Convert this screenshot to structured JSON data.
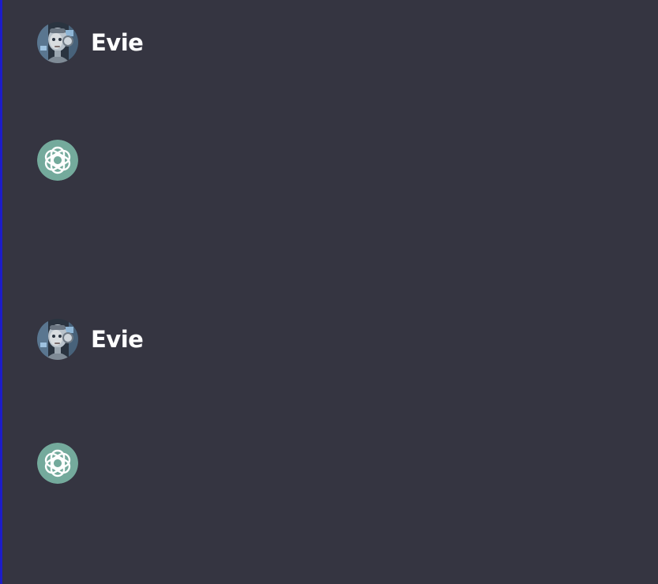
{
  "messages": [
    {
      "role": "user",
      "sender": "Evie",
      "avatar_icon": "robot-avatar-icon"
    },
    {
      "role": "assistant",
      "sender": "",
      "avatar_icon": "openai-logo-icon"
    },
    {
      "role": "user",
      "sender": "Evie",
      "avatar_icon": "robot-avatar-icon"
    },
    {
      "role": "assistant",
      "sender": "",
      "avatar_icon": "openai-logo-icon"
    }
  ],
  "colors": {
    "background": "#353541",
    "assistant_avatar": "#74aa9c",
    "left_border": "#1c1cc8",
    "text": "#ffffff"
  }
}
